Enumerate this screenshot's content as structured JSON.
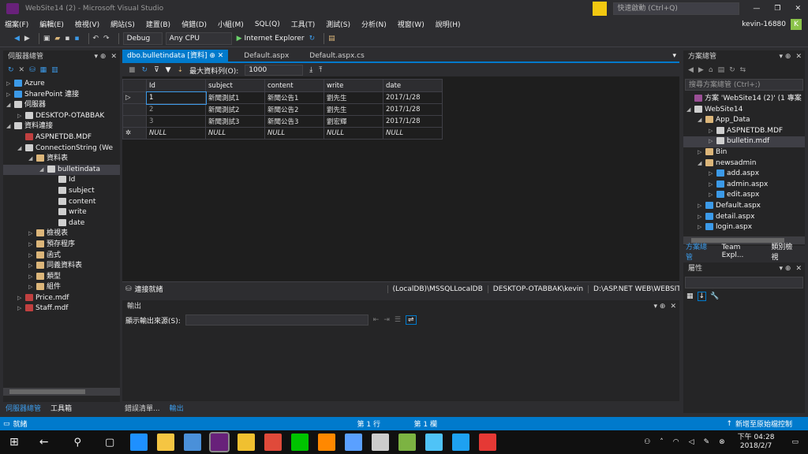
{
  "window": {
    "title": "WebSite14 (2) - Microsoft Visual Studio",
    "quick_launch": "快速啟動 (Ctrl+Q)",
    "user": "kevin-16880",
    "user_initial": "K"
  },
  "menu": [
    "檔案(F)",
    "編輯(E)",
    "檢視(V)",
    "網站(S)",
    "建置(B)",
    "偵錯(D)",
    "小組(M)",
    "SQL(Q)",
    "工具(T)",
    "測試(S)",
    "分析(N)",
    "視窗(W)",
    "說明(H)"
  ],
  "toolbar": {
    "config": "Debug",
    "platform": "Any CPU",
    "run": "Internet Explorer"
  },
  "server_explorer": {
    "title": "伺服器總管",
    "items": [
      {
        "label": "Azure",
        "indent": 0,
        "tri": "▷",
        "color": "#3c9ae8"
      },
      {
        "label": "SharePoint 連接",
        "indent": 0,
        "tri": "▷",
        "color": "#3c9ae8"
      },
      {
        "label": "伺服器",
        "indent": 0,
        "tri": "◢",
        "color": "#cfcfcf"
      },
      {
        "label": "DESKTOP-OTABBAK",
        "indent": 1,
        "tri": "▷",
        "color": "#cfcfcf"
      },
      {
        "label": "資料連接",
        "indent": 0,
        "tri": "◢",
        "color": "#cfcfcf"
      },
      {
        "label": "ASPNETDB.MDF",
        "indent": 1,
        "tri": "",
        "color": "#c04040"
      },
      {
        "label": "ConnectionString (We",
        "indent": 1,
        "tri": "◢",
        "color": "#cfcfcf"
      },
      {
        "label": "資料表",
        "indent": 2,
        "tri": "◢",
        "color": "#dcb67a"
      },
      {
        "label": "bulletindata",
        "indent": 3,
        "tri": "◢",
        "color": "#cfcfcf",
        "selected": true
      },
      {
        "label": "Id",
        "indent": 4,
        "tri": "",
        "color": "#cfcfcf"
      },
      {
        "label": "subject",
        "indent": 4,
        "tri": "",
        "color": "#cfcfcf"
      },
      {
        "label": "content",
        "indent": 4,
        "tri": "",
        "color": "#cfcfcf"
      },
      {
        "label": "write",
        "indent": 4,
        "tri": "",
        "color": "#cfcfcf"
      },
      {
        "label": "date",
        "indent": 4,
        "tri": "",
        "color": "#cfcfcf"
      },
      {
        "label": "檢視表",
        "indent": 2,
        "tri": "▷",
        "color": "#dcb67a"
      },
      {
        "label": "預存程序",
        "indent": 2,
        "tri": "▷",
        "color": "#dcb67a"
      },
      {
        "label": "函式",
        "indent": 2,
        "tri": "▷",
        "color": "#dcb67a"
      },
      {
        "label": "同義資料表",
        "indent": 2,
        "tri": "▷",
        "color": "#dcb67a"
      },
      {
        "label": "類型",
        "indent": 2,
        "tri": "▷",
        "color": "#dcb67a"
      },
      {
        "label": "組件",
        "indent": 2,
        "tri": "▷",
        "color": "#dcb67a"
      },
      {
        "label": "Price.mdf",
        "indent": 1,
        "tri": "▷",
        "color": "#c04040"
      },
      {
        "label": "Staff.mdf",
        "indent": 1,
        "tri": "▷",
        "color": "#c04040"
      }
    ],
    "bottom_tabs": [
      "伺服器總管",
      "工具箱"
    ]
  },
  "doc_tabs": [
    {
      "label": "dbo.bulletindata [資料]",
      "active": true
    },
    {
      "label": "Default.aspx"
    },
    {
      "label": "Default.aspx.cs"
    }
  ],
  "grid_toolbar": {
    "max_rows_label": "最大資料列(O):",
    "max_rows": "1000"
  },
  "table": {
    "columns": [
      "Id",
      "subject",
      "content",
      "write",
      "date"
    ],
    "rows": [
      [
        "1",
        "新聞測試1",
        "新聞公告1",
        "劉先生",
        "2017/1/28"
      ],
      [
        "2",
        "新聞測試2",
        "新聞公告2",
        "劉先生",
        "2017/1/28"
      ],
      [
        "3",
        "新聞測試3",
        "新聞公告3",
        "劉宏輝",
        "2017/1/28"
      ],
      [
        "NULL",
        "NULL",
        "NULL",
        "NULL",
        "NULL"
      ]
    ]
  },
  "conn_status": {
    "state": "連接就緒",
    "db": "(LocalDB)\\MSSQLLocalDB",
    "host": "DESKTOP-OTABBAK\\kevin",
    "path": "D:\\ASP.NET WEB\\WEBSITE..."
  },
  "output": {
    "title": "輸出",
    "source_label": "顯示輸出來源(S):",
    "tabs": [
      "錯誤清單...",
      "輸出"
    ]
  },
  "solution_explorer": {
    "title": "方案總管",
    "search": "搜尋方案總管 (Ctrl+;)",
    "items": [
      {
        "label": "方案 'WebSite14 (2)' (1 專案",
        "indent": 0,
        "tri": "",
        "color": "#9b4f96"
      },
      {
        "label": "WebSite14",
        "indent": 0,
        "tri": "◢",
        "color": "#cfcfcf"
      },
      {
        "label": "App_Data",
        "indent": 1,
        "tri": "◢",
        "color": "#dcb67a"
      },
      {
        "label": "ASPNETDB.MDF",
        "indent": 2,
        "tri": "▷",
        "color": "#cfcfcf"
      },
      {
        "label": "bulletin.mdf",
        "indent": 2,
        "tri": "▷",
        "color": "#cfcfcf",
        "selected": true
      },
      {
        "label": "Bin",
        "indent": 1,
        "tri": "▷",
        "color": "#dcb67a"
      },
      {
        "label": "newsadmin",
        "indent": 1,
        "tri": "◢",
        "color": "#dcb67a"
      },
      {
        "label": "add.aspx",
        "indent": 2,
        "tri": "▷",
        "color": "#3c9ae8"
      },
      {
        "label": "admin.aspx",
        "indent": 2,
        "tri": "▷",
        "color": "#3c9ae8"
      },
      {
        "label": "edit.aspx",
        "indent": 2,
        "tri": "▷",
        "color": "#3c9ae8"
      },
      {
        "label": "Default.aspx",
        "indent": 1,
        "tri": "▷",
        "color": "#3c9ae8"
      },
      {
        "label": "detail.aspx",
        "indent": 1,
        "tri": "▷",
        "color": "#3c9ae8"
      },
      {
        "label": "login.aspx",
        "indent": 1,
        "tri": "▷",
        "color": "#3c9ae8"
      }
    ],
    "tabs": [
      "方案總管",
      "Team Expl...",
      "類別檢視"
    ]
  },
  "properties": {
    "title": "屬性"
  },
  "status": {
    "left": "就緒",
    "line": "第 1 行",
    "col": "第 1 欄",
    "right": "新增至原始檔控制"
  },
  "taskbar": {
    "time": "下午 04:28",
    "date": "2018/2/7",
    "icons": [
      {
        "name": "edge-icon",
        "color": "#1e90ff"
      },
      {
        "name": "explorer-icon",
        "color": "#f5c542"
      },
      {
        "name": "store-icon",
        "color": "#4a90d9"
      },
      {
        "name": "visual-studio-icon",
        "color": "#68217a"
      },
      {
        "name": "app-icon",
        "color": "#f0c030"
      },
      {
        "name": "chrome-icon",
        "color": "#e04a3a"
      },
      {
        "name": "line-icon",
        "color": "#00c300"
      },
      {
        "name": "app2-icon",
        "color": "#ff8800"
      },
      {
        "name": "app3-icon",
        "color": "#5aa0ff"
      },
      {
        "name": "mail-icon",
        "color": "#cccccc"
      },
      {
        "name": "app4-icon",
        "color": "#7cb342"
      },
      {
        "name": "paint-icon",
        "color": "#4fc3f7"
      },
      {
        "name": "ie-icon",
        "color": "#1ea1f1"
      },
      {
        "name": "app5-icon",
        "color": "#e53935"
      }
    ]
  }
}
